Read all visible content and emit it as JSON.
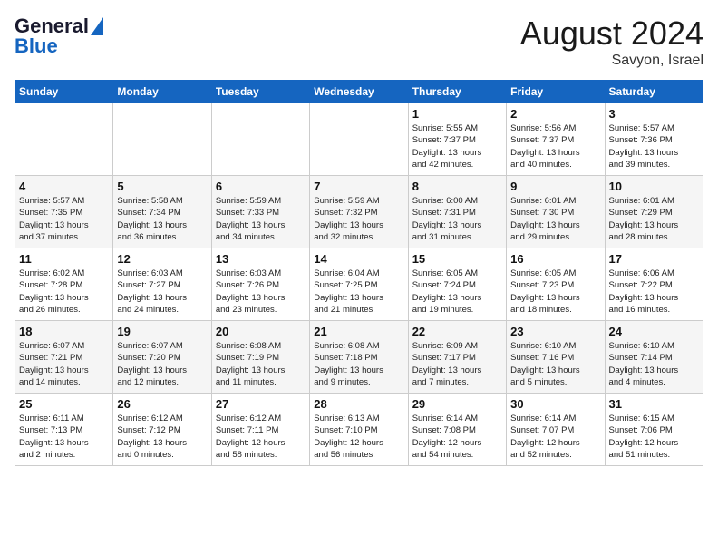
{
  "header": {
    "logo_line1": "General",
    "logo_line2": "Blue",
    "month_year": "August 2024",
    "location": "Savyon, Israel"
  },
  "weekdays": [
    "Sunday",
    "Monday",
    "Tuesday",
    "Wednesday",
    "Thursday",
    "Friday",
    "Saturday"
  ],
  "weeks": [
    [
      {
        "day": "",
        "info": ""
      },
      {
        "day": "",
        "info": ""
      },
      {
        "day": "",
        "info": ""
      },
      {
        "day": "",
        "info": ""
      },
      {
        "day": "1",
        "info": "Sunrise: 5:55 AM\nSunset: 7:37 PM\nDaylight: 13 hours\nand 42 minutes."
      },
      {
        "day": "2",
        "info": "Sunrise: 5:56 AM\nSunset: 7:37 PM\nDaylight: 13 hours\nand 40 minutes."
      },
      {
        "day": "3",
        "info": "Sunrise: 5:57 AM\nSunset: 7:36 PM\nDaylight: 13 hours\nand 39 minutes."
      }
    ],
    [
      {
        "day": "4",
        "info": "Sunrise: 5:57 AM\nSunset: 7:35 PM\nDaylight: 13 hours\nand 37 minutes."
      },
      {
        "day": "5",
        "info": "Sunrise: 5:58 AM\nSunset: 7:34 PM\nDaylight: 13 hours\nand 36 minutes."
      },
      {
        "day": "6",
        "info": "Sunrise: 5:59 AM\nSunset: 7:33 PM\nDaylight: 13 hours\nand 34 minutes."
      },
      {
        "day": "7",
        "info": "Sunrise: 5:59 AM\nSunset: 7:32 PM\nDaylight: 13 hours\nand 32 minutes."
      },
      {
        "day": "8",
        "info": "Sunrise: 6:00 AM\nSunset: 7:31 PM\nDaylight: 13 hours\nand 31 minutes."
      },
      {
        "day": "9",
        "info": "Sunrise: 6:01 AM\nSunset: 7:30 PM\nDaylight: 13 hours\nand 29 minutes."
      },
      {
        "day": "10",
        "info": "Sunrise: 6:01 AM\nSunset: 7:29 PM\nDaylight: 13 hours\nand 28 minutes."
      }
    ],
    [
      {
        "day": "11",
        "info": "Sunrise: 6:02 AM\nSunset: 7:28 PM\nDaylight: 13 hours\nand 26 minutes."
      },
      {
        "day": "12",
        "info": "Sunrise: 6:03 AM\nSunset: 7:27 PM\nDaylight: 13 hours\nand 24 minutes."
      },
      {
        "day": "13",
        "info": "Sunrise: 6:03 AM\nSunset: 7:26 PM\nDaylight: 13 hours\nand 23 minutes."
      },
      {
        "day": "14",
        "info": "Sunrise: 6:04 AM\nSunset: 7:25 PM\nDaylight: 13 hours\nand 21 minutes."
      },
      {
        "day": "15",
        "info": "Sunrise: 6:05 AM\nSunset: 7:24 PM\nDaylight: 13 hours\nand 19 minutes."
      },
      {
        "day": "16",
        "info": "Sunrise: 6:05 AM\nSunset: 7:23 PM\nDaylight: 13 hours\nand 18 minutes."
      },
      {
        "day": "17",
        "info": "Sunrise: 6:06 AM\nSunset: 7:22 PM\nDaylight: 13 hours\nand 16 minutes."
      }
    ],
    [
      {
        "day": "18",
        "info": "Sunrise: 6:07 AM\nSunset: 7:21 PM\nDaylight: 13 hours\nand 14 minutes."
      },
      {
        "day": "19",
        "info": "Sunrise: 6:07 AM\nSunset: 7:20 PM\nDaylight: 13 hours\nand 12 minutes."
      },
      {
        "day": "20",
        "info": "Sunrise: 6:08 AM\nSunset: 7:19 PM\nDaylight: 13 hours\nand 11 minutes."
      },
      {
        "day": "21",
        "info": "Sunrise: 6:08 AM\nSunset: 7:18 PM\nDaylight: 13 hours\nand 9 minutes."
      },
      {
        "day": "22",
        "info": "Sunrise: 6:09 AM\nSunset: 7:17 PM\nDaylight: 13 hours\nand 7 minutes."
      },
      {
        "day": "23",
        "info": "Sunrise: 6:10 AM\nSunset: 7:16 PM\nDaylight: 13 hours\nand 5 minutes."
      },
      {
        "day": "24",
        "info": "Sunrise: 6:10 AM\nSunset: 7:14 PM\nDaylight: 13 hours\nand 4 minutes."
      }
    ],
    [
      {
        "day": "25",
        "info": "Sunrise: 6:11 AM\nSunset: 7:13 PM\nDaylight: 13 hours\nand 2 minutes."
      },
      {
        "day": "26",
        "info": "Sunrise: 6:12 AM\nSunset: 7:12 PM\nDaylight: 13 hours\nand 0 minutes."
      },
      {
        "day": "27",
        "info": "Sunrise: 6:12 AM\nSunset: 7:11 PM\nDaylight: 12 hours\nand 58 minutes."
      },
      {
        "day": "28",
        "info": "Sunrise: 6:13 AM\nSunset: 7:10 PM\nDaylight: 12 hours\nand 56 minutes."
      },
      {
        "day": "29",
        "info": "Sunrise: 6:14 AM\nSunset: 7:08 PM\nDaylight: 12 hours\nand 54 minutes."
      },
      {
        "day": "30",
        "info": "Sunrise: 6:14 AM\nSunset: 7:07 PM\nDaylight: 12 hours\nand 52 minutes."
      },
      {
        "day": "31",
        "info": "Sunrise: 6:15 AM\nSunset: 7:06 PM\nDaylight: 12 hours\nand 51 minutes."
      }
    ]
  ]
}
